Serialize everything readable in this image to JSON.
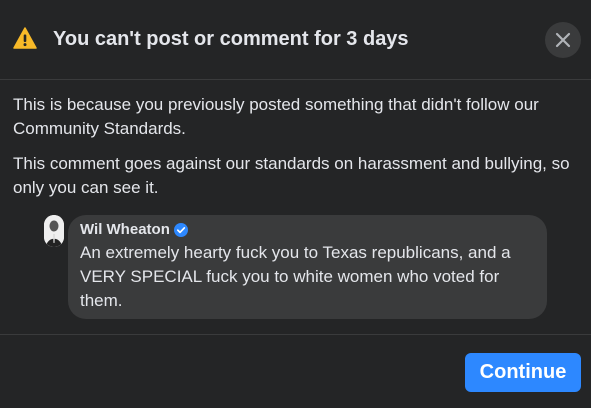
{
  "dialog": {
    "title": "You can't post or comment for 3 days",
    "close_icon": "close-icon",
    "warning_icon": "warning-triangle-icon",
    "warning_color": "#f7b928"
  },
  "body": {
    "paragraph_1": "This is because you previously posted something that didn't follow our Community Standards.",
    "paragraph_2": "This comment goes against our standards on harassment and bullying, so only you can see it."
  },
  "comment": {
    "author": "Wil Wheaton",
    "verified": true,
    "verified_color": "#2d88ff",
    "text": "An extremely hearty fuck you to Texas republicans, and a VERY SPECIAL fuck you to white women who voted for them."
  },
  "footer": {
    "continue_label": "Continue",
    "button_color": "#2d88ff"
  }
}
